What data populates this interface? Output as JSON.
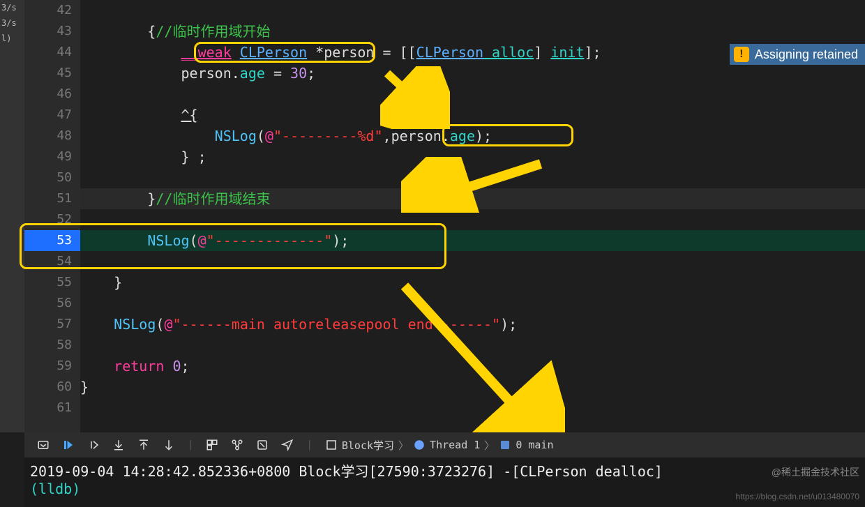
{
  "leftbar": {
    "items": [
      "3/s",
      "3/s",
      "l)"
    ]
  },
  "gutter": {
    "lines": [
      "42",
      "43",
      "44",
      "45",
      "46",
      "47",
      "48",
      "49",
      "50",
      "51",
      "52",
      "53",
      "54",
      "55",
      "56",
      "57",
      "58",
      "59",
      "60",
      "61"
    ],
    "breakpoint_line": "53"
  },
  "code": {
    "l43_brace": "{",
    "l43_comment": "//临时作用域开始",
    "l44_weak": "__weak",
    "l44_type": "CLPerson",
    "l44_star": " *",
    "l44_var": "person = [[",
    "l44_type2": "CLPerson",
    "l44_alloc": " alloc",
    "l44_bracket": "] ",
    "l44_init": "init",
    "l44_end": "];",
    "l45_prefix": "person.",
    "l45_prop": "age",
    "l45_eq": " = ",
    "l45_num": "30",
    "l45_semi": ";",
    "l47_caret": "^{",
    "l48_nslog": "NSLog",
    "l48_open": "(",
    "l48_at": "@",
    "l48_str": "\"---------%d\"",
    "l48_comma": ",",
    "l48_person": "person",
    "l48_dot": ".",
    "l48_age": "age",
    "l48_close": ");",
    "l49_close": "} ;",
    "l51_brace": "}",
    "l51_comment": "//临时作用域结束",
    "l53_nslog": "NSLog",
    "l53_open": "(",
    "l53_at": "@",
    "l53_str": "\"-------------\"",
    "l53_close": ");",
    "l55_brace": "}",
    "l57_nslog": "NSLog",
    "l57_open": "(",
    "l57_at": "@",
    "l57_str": "\"------main autoreleasepool end-------\"",
    "l57_close": ");",
    "l59_return": "return",
    "l59_zero": " 0",
    "l59_semi": ";",
    "l60_brace": "}"
  },
  "warning": {
    "icon": "!",
    "text": "Assigning retained"
  },
  "debugbar": {
    "crumbs": {
      "project": "Block学习",
      "thread": "Thread 1",
      "frame": "0 main"
    }
  },
  "console": {
    "line1_ts": "2019-09-04 14:28:42.852336+0800 Block学习[27590:3723276] ",
    "line1_msg": "-[CLPerson dealloc]",
    "prompt": "(lldb) "
  },
  "watermarks": {
    "juejin": "@稀土掘金技术社区",
    "csdn": "https://blog.csdn.net/u013480070"
  }
}
